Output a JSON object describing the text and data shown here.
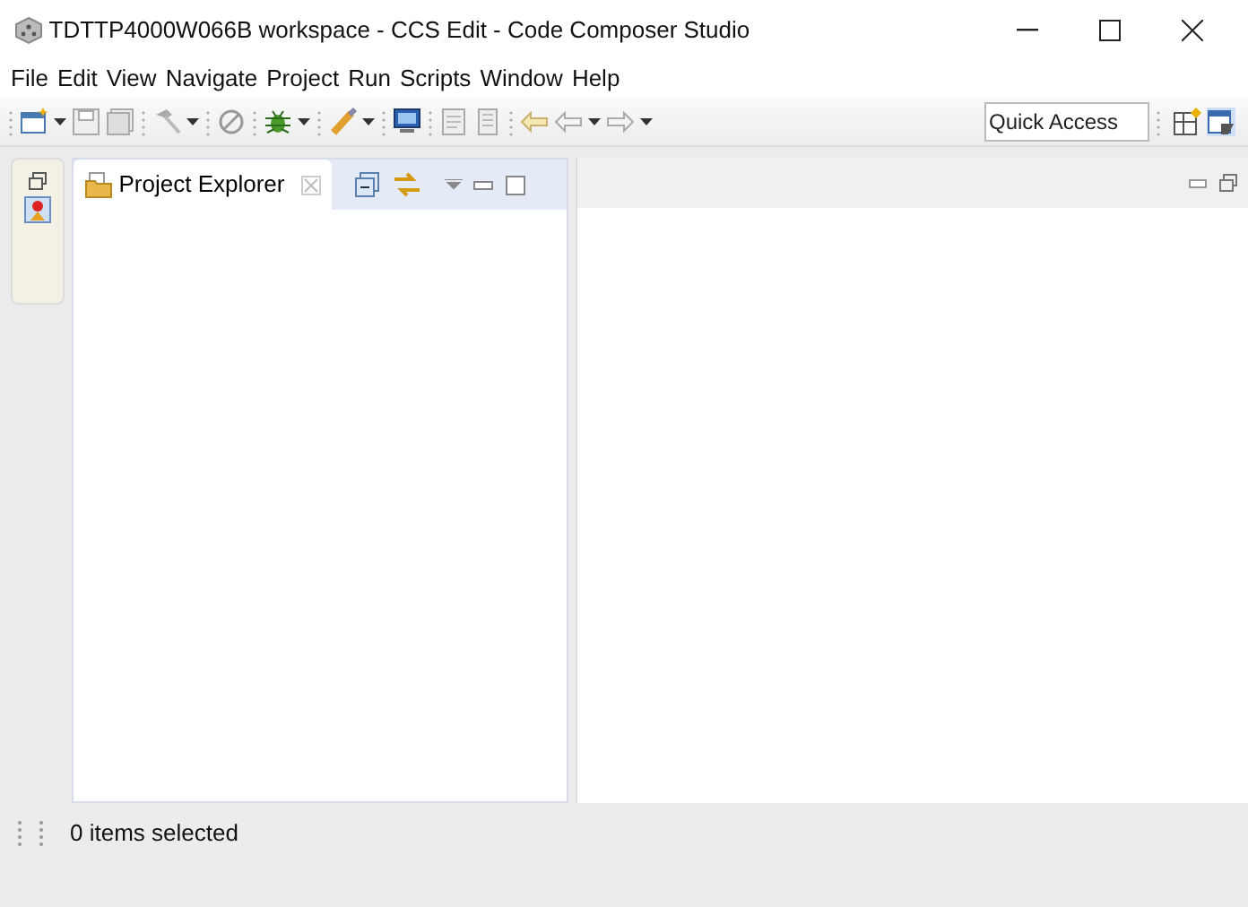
{
  "window": {
    "title": "TDTTP4000W066B workspace - CCS Edit - Code Composer Studio"
  },
  "menu": [
    "File",
    "Edit",
    "View",
    "Navigate",
    "Project",
    "Run",
    "Scripts",
    "Window",
    "Help"
  ],
  "quick_access": {
    "placeholder": "Quick Access"
  },
  "view_tabs": [
    {
      "label": "Project Explorer",
      "selected": true
    }
  ],
  "status_bar": {
    "text": "0 items selected"
  }
}
